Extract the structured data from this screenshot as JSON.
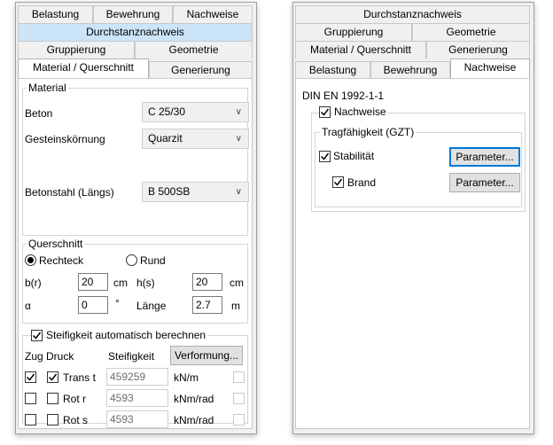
{
  "left": {
    "tabs_row1": [
      "Belastung",
      "Bewehrung",
      "Nachweise"
    ],
    "tabs_row2": "Durchstanznachweis",
    "tabs_row3": [
      "Gruppierung",
      "Geometrie"
    ],
    "tabs_row4": [
      "Material / Querschnitt",
      "Generierung"
    ],
    "material": {
      "legend": "Material",
      "beton_label": "Beton",
      "beton_value": "C 25/30",
      "gestein_label": "Gesteinskörnung",
      "gestein_value": "Quarzit",
      "stahl_label": "Betonstahl (Längs)",
      "stahl_value": "B 500SB"
    },
    "querschnitt": {
      "legend": "Querschnitt",
      "rechteck": "Rechteck",
      "rund": "Rund",
      "b_label": "b(r)",
      "b_value": "20",
      "b_unit": "cm",
      "h_label": "h(s)",
      "h_value": "20",
      "h_unit": "cm",
      "alpha_label": "α",
      "alpha_value": "0",
      "alpha_unit": "°",
      "laenge_label": "Länge",
      "laenge_value": "2.7",
      "laenge_unit": "m"
    },
    "steifigkeit": {
      "legend": "Steifigkeit automatisch berechnen",
      "col_zug_druck": "Zug Druck",
      "col_steifigkeit": "Steifigkeit",
      "verformung_button": "Verformung...",
      "rows": [
        {
          "label": "Trans t",
          "value": "459259",
          "unit": "kN/m",
          "zug": true,
          "druck": true
        },
        {
          "label": "Rot r",
          "value": "4593",
          "unit": "kNm/rad",
          "zug": false,
          "druck": false
        },
        {
          "label": "Rot s",
          "value": "4593",
          "unit": "kNm/rad",
          "zug": false,
          "druck": false
        }
      ]
    }
  },
  "right": {
    "tabs_row1": "Durchstanznachweis",
    "tabs_row2": [
      "Gruppierung",
      "Geometrie"
    ],
    "tabs_row3": [
      "Material / Querschnitt",
      "Generierung"
    ],
    "tabs_row4": [
      "Belastung",
      "Bewehrung",
      "Nachweise"
    ],
    "norm": "DIN EN 1992-1-1",
    "nachweise_label": "Nachweise",
    "gzt_legend": "Tragfähigkeit (GZT)",
    "stabilitaet_label": "Stabilität",
    "brand_label": "Brand",
    "parameter_button": "Parameter..."
  }
}
